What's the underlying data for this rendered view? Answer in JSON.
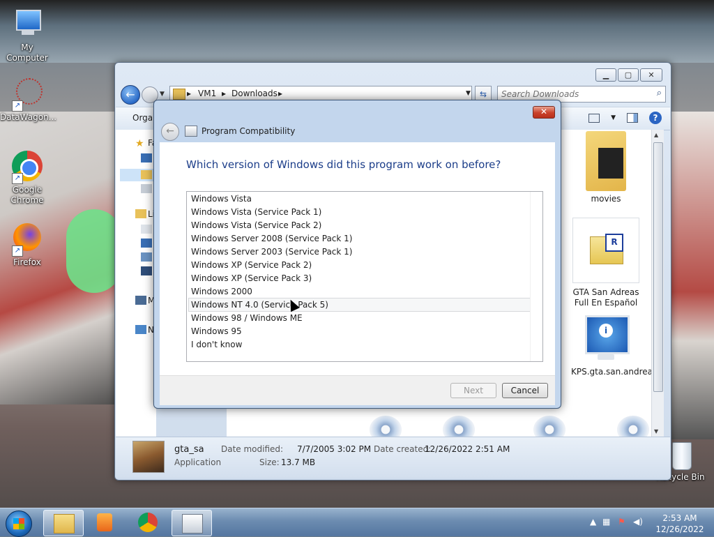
{
  "desktop": {
    "icons": [
      {
        "label": "My Computer"
      },
      {
        "label": "DataWagon..."
      },
      {
        "label": "Google Chrome"
      },
      {
        "label": "Firefox"
      },
      {
        "label": "Recycle Bin"
      }
    ]
  },
  "explorer": {
    "address": {
      "crumbs": [
        "VM1",
        "Downloads"
      ]
    },
    "search_placeholder": "Search Downloads",
    "organize_label": "Organ",
    "nav_letters": {
      "favorites": "Fa",
      "libraries": "Li",
      "computer": "M",
      "network": "N"
    },
    "files": [
      {
        "name": "movies"
      },
      {
        "name": "GTA San Adreas Full En Español"
      },
      {
        "name": "KPS.gta.san.andreas"
      }
    ],
    "details": {
      "name": "gta_sa",
      "type": "Application",
      "date_modified_label": "Date modified:",
      "date_modified": "7/7/2005 3:02 PM",
      "size_label": "Size:",
      "size": "13.7 MB",
      "date_created_label": "Date created:",
      "date_created": "12/26/2022 2:51 AM"
    }
  },
  "dialog": {
    "title": "Program Compatibility",
    "question": "Which version of Windows did this program work on before?",
    "options": [
      "Windows Vista",
      "Windows Vista (Service Pack 1)",
      "Windows Vista (Service Pack 2)",
      "Windows Server 2008 (Service Pack 1)",
      "Windows Server 2003 (Service Pack 1)",
      "Windows XP (Service Pack 2)",
      "Windows XP (Service Pack 3)",
      "Windows 2000",
      "Windows NT 4.0 (Service Pack 5)",
      "Windows 98 / Windows ME",
      "Windows 95",
      "I don't know"
    ],
    "hovered_option": "Windows NT 4.0 (Service Pack 5)",
    "next_label": "Next",
    "cancel_label": "Cancel"
  },
  "taskbar": {
    "time": "2:53 AM",
    "date": "12/26/2022"
  }
}
